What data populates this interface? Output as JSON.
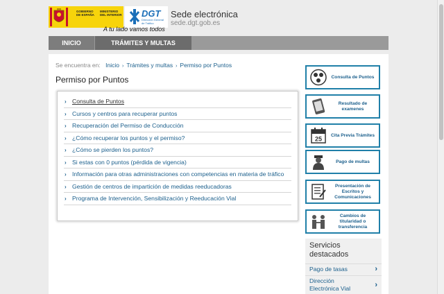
{
  "header": {
    "gobierno": "GOBIERNO DE ESPAÑA",
    "ministerio": "MINISTERIO DEL INTERIOR",
    "dgt": "DGT",
    "dgt_sub": "Dirección General de Tráfico",
    "slogan": "A tu lado vamos todos",
    "site_title": "Sede electrónica",
    "site_url": "sede.dgt.gob.es"
  },
  "nav": {
    "inicio": "INICIO",
    "tramites": "TRÁMITES Y MULTAS"
  },
  "breadcrumb": {
    "prefix": "Se encuentra en:",
    "items": [
      "Inicio",
      "Trámites y multas",
      "Permiso por Puntos"
    ]
  },
  "page_title": "Permiso por Puntos",
  "links": [
    "Consulta de Puntos",
    "Cursos y centros para recuperar puntos",
    "Recuperación del Permiso de Conducción",
    "¿Cómo recuperar los puntos y el permiso?",
    "¿Cómo se pierden los puntos?",
    "Si estas con 0 puntos (pérdida de vigencia)",
    "Información para otras administraciones con competencias en materia de tráfico",
    "Gestión de centros de impartición de medidas reeducadoras",
    "Programa de Intervención, Sensibilización y Reeducación Vial"
  ],
  "tiles": [
    {
      "label": "Consulta de Puntos",
      "icon": "points-icon"
    },
    {
      "label": "Resultado de examenes",
      "icon": "phone-icon"
    },
    {
      "label": "Cita Previa Trámites",
      "icon": "calendar-icon",
      "day": "25"
    },
    {
      "label": "Pago de multas",
      "icon": "officer-icon"
    },
    {
      "label": "Presentación de Escritos y Comunicaciones",
      "icon": "document-icon"
    },
    {
      "label": "Cambios de titularidad o transferencia",
      "icon": "transfer-icon"
    }
  ],
  "servicios": {
    "title": "Servicios destacados",
    "items": [
      "Pago de tasas",
      "Dirección Electrónica Vial"
    ]
  },
  "colors": {
    "accent": "#1f7fa8",
    "link": "#1b5f8c",
    "nav": "#9a9a9a",
    "gov_yellow": "#f7d40b"
  }
}
